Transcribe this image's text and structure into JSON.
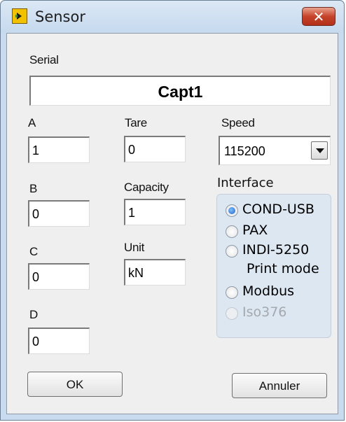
{
  "window": {
    "title": "Sensor",
    "close_label": "✕"
  },
  "serial": {
    "label": "Serial",
    "value": "Capt1"
  },
  "coefficients": {
    "a": {
      "label": "A",
      "value": "1"
    },
    "b": {
      "label": "B",
      "value": "0"
    },
    "c": {
      "label": "C",
      "value": "0"
    },
    "d": {
      "label": "D",
      "value": "0"
    }
  },
  "tare": {
    "label": "Tare",
    "value": "0"
  },
  "capacity": {
    "label": "Capacity",
    "value": "1"
  },
  "unit": {
    "label": "Unit",
    "value": "kN"
  },
  "speed": {
    "label": "Speed",
    "value": "115200"
  },
  "interface": {
    "label": "Interface",
    "options": [
      {
        "label": "COND-USB",
        "checked": true,
        "disabled": false
      },
      {
        "label": "PAX",
        "checked": false,
        "disabled": false
      },
      {
        "label": "INDI-5250",
        "label2": "Print mode",
        "checked": false,
        "disabled": false
      },
      {
        "label": "Modbus",
        "checked": false,
        "disabled": false
      },
      {
        "label": "Iso376",
        "checked": false,
        "disabled": true
      }
    ]
  },
  "buttons": {
    "ok": "OK",
    "cancel": "Annuler"
  }
}
